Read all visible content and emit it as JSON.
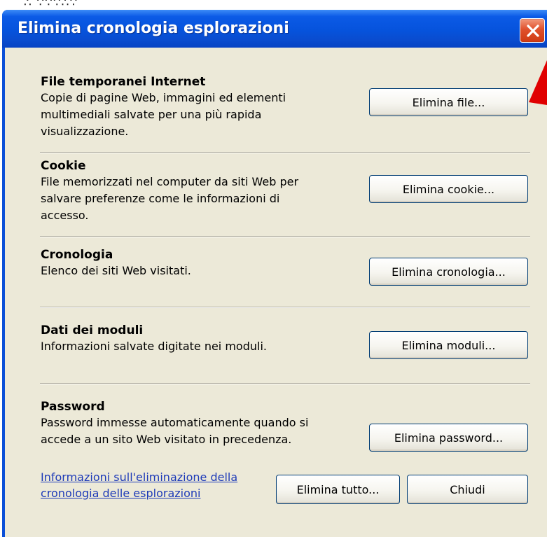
{
  "window": {
    "title": "Elimina cronologia esplorazioni",
    "behind_text": "∴ ∵∵∵∴∵"
  },
  "sections": [
    {
      "heading": "File temporanei Internet",
      "description_lines": [
        "Copie di pagine Web, immagini ed elementi",
        "multimediali salvate per una più rapida",
        "visualizzazione."
      ],
      "button_label": "Elimina file..."
    },
    {
      "heading": "Cookie",
      "description_lines": [
        "File memorizzati nel computer da siti Web per",
        "salvare preferenze come le informazioni di",
        "accesso."
      ],
      "button_label": "Elimina cookie..."
    },
    {
      "heading": "Cronologia",
      "description_lines": [
        "Elenco dei siti Web visitati."
      ],
      "button_label": "Elimina cronologia..."
    },
    {
      "heading": "Dati dei moduli",
      "description_lines": [
        "Informazioni salvate digitate nei moduli."
      ],
      "button_label": "Elimina moduli..."
    },
    {
      "heading": "Password",
      "description_lines": [
        "Password immesse automaticamente quando si",
        "accede a un sito Web visitato in precedenza."
      ],
      "button_label": "Elimina password..."
    }
  ],
  "footer": {
    "link_lines": [
      "Informazioni sull'eliminazione della",
      "cronologia delle esplorazioni"
    ],
    "delete_all_label": "Elimina tutto...",
    "close_label": "Chiudi"
  },
  "colors": {
    "titlebar": "#0653dc",
    "client_bg": "#ece9d8",
    "link": "#1d3ab8",
    "annotation_arrow": "#e00000"
  }
}
